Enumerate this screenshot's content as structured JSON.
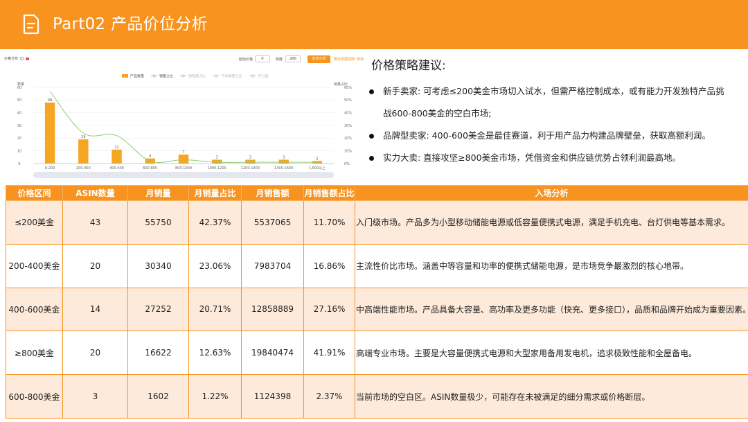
{
  "header": {
    "title": "Part02 产品价位分析",
    "icon": "document-icon"
  },
  "chart_toolbar": {
    "title": "价格分布",
    "start_label": "起始价格",
    "start_value": "0",
    "span_label": "跨度",
    "span_value": "200",
    "query_button": "查询分析",
    "help_link": "脚本数据说明: 帮助"
  },
  "chart_data": {
    "type": "bar",
    "categories": [
      "0-200",
      "200-400",
      "400-600",
      "600-800",
      "800-1000",
      "1000-1200",
      "1200-1400",
      "1400-1600",
      "1,600以上"
    ],
    "series": [
      {
        "name": "产品数量",
        "type": "bar",
        "values": [
          48,
          19,
          11,
          4,
          7,
          3,
          3,
          3,
          2
        ]
      },
      {
        "name": "销量占比",
        "type": "line",
        "values": [
          57,
          24,
          22,
          2,
          3,
          1,
          1,
          1,
          1
        ]
      }
    ],
    "legend": [
      "产品数量",
      "销量占比",
      "销售额占比",
      "平均销量占比",
      "评分值"
    ],
    "ylabel": "数量",
    "y2label": "销量占比",
    "ylim": [
      0,
      60
    ],
    "y2lim": [
      0,
      60
    ],
    "yticks": [
      "0",
      "10",
      "20",
      "30",
      "40",
      "50",
      "60"
    ],
    "y2ticks": [
      "0%",
      "10%",
      "20%",
      "30%",
      "40%",
      "50%",
      "60%"
    ],
    "bar_color": "#f5a623",
    "line_color": "#91cc75",
    "legend_placement": "top-center"
  },
  "strategy": {
    "title": "价格策略建议:",
    "items": [
      "新手卖家: 可考虑≤200美金市场切入试水，但需严格控制成本，或有能力开发独特产品挑",
      "战600-800美金的空白市场;",
      "品牌型卖家: 400-600美金是最佳赛道，利于用产品力构建品牌壁垒，获取高额利润。",
      "实力大卖: 直接攻坚≥800美金市场，凭借资金和供应链优势占领利润最高地。"
    ]
  },
  "table": {
    "headers": [
      "价格区间",
      "ASIN数量",
      "月销量",
      "月销量占比",
      "月销售额",
      "月销售额占比",
      "入场分析"
    ],
    "rows": [
      [
        "≤200美金",
        "43",
        "55750",
        "42.37%",
        "5537065",
        "11.70%",
        "入门级市场。产品多为小型移动储能电源或低容量便携式电源，满足手机充电、台灯供电等基本需求。"
      ],
      [
        "200-400美金",
        "20",
        "30340",
        "23.06%",
        "7983704",
        "16.86%",
        "主流性价比市场。涵盖中等容量和功率的便携式储能电源，是市场竞争最激烈的核心地带。"
      ],
      [
        "400-600美金",
        "14",
        "27252",
        "20.71%",
        "12858889",
        "27.16%",
        "中高端性能市场。产品具备大容量、高功率及更多功能（快充、更多接口），品质和品牌开始成为重要因素。"
      ],
      [
        "≥800美金",
        "20",
        "16622",
        "12.63%",
        "19840474",
        "41.91%",
        "高端专业市场。主要是大容量便携式电源和大型家用备用发电机，追求极致性能和全屋备电。"
      ],
      [
        "600-800美金",
        "3",
        "1602",
        "1.22%",
        "1124398",
        "2.37%",
        "当前市场的空白区。ASIN数量极少，可能存在未被满足的细分需求或价格断层。"
      ]
    ]
  }
}
